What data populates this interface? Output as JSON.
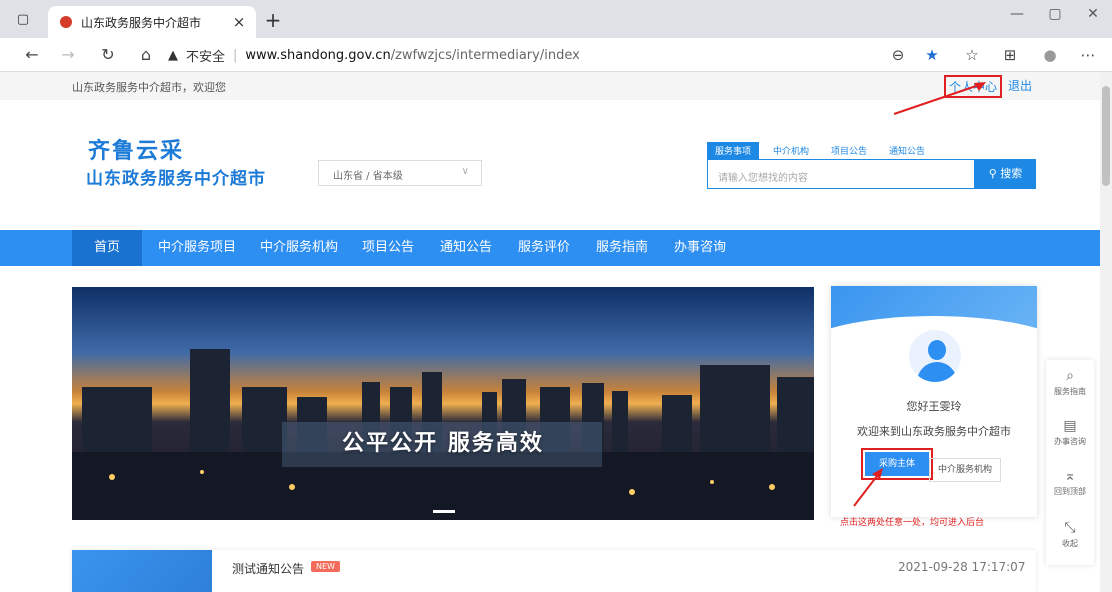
{
  "browser": {
    "tab_title": "山东政务服务中介超市",
    "tab_close": "×",
    "new_tab": "+",
    "security_label": "不安全",
    "url_host": "www.shandong.gov.cn",
    "url_path": "/zwfwzjcs/intermediary/index",
    "icons": [
      "sidebar-icon",
      "back-icon",
      "forward-icon",
      "refresh-icon",
      "home-icon",
      "warning-icon",
      "zoom-icon",
      "favorite-star-icon",
      "favorites-list-icon",
      "collections-icon",
      "profile-icon",
      "more-icon"
    ]
  },
  "topbar": {
    "welcome": "山东政务服务中介超市，欢迎您",
    "user_center": "个人中心",
    "logout": "退出"
  },
  "logo": {
    "line1": "齐鲁云采",
    "line2": "山东政务服务中介超市"
  },
  "region_select": {
    "value": "山东省 / 省本级"
  },
  "search": {
    "tabs": [
      "服务事项",
      "中介机构",
      "项目公告",
      "通知公告"
    ],
    "active_tab": "服务事项",
    "placeholder": "请输入您想找的内容",
    "button": "搜索"
  },
  "nav": {
    "items": [
      "首页",
      "中介服务项目",
      "中介服务机构",
      "项目公告",
      "通知公告",
      "服务评价",
      "服务指南",
      "办事咨询"
    ],
    "active": "首页"
  },
  "banner": {
    "slogan": "公平公开  服务高效"
  },
  "user_card": {
    "greeting": "您好王雯玲",
    "welcome": "欢迎来到山东政务服务中介超市",
    "btn_buyer": "采购主体",
    "btn_agency": "中介服务机构"
  },
  "hint": "点击这两处任意一处，均可进入后台",
  "side_tools": [
    {
      "label": "服务指南",
      "icon": "guide-icon"
    },
    {
      "label": "办事咨询",
      "icon": "consult-icon"
    },
    {
      "label": "回到顶部",
      "icon": "back-to-top-icon"
    },
    {
      "label": "收起",
      "icon": "collapse-icon"
    }
  ],
  "notice": {
    "title": "测试通知公告",
    "badge": "NEW",
    "date": "2021-09-28 17:17:07"
  },
  "colors": {
    "primary": "#2e8ff2",
    "highlight_border": "#e02020",
    "hint_text": "#e02020",
    "nav_active": "#1a72d0"
  }
}
